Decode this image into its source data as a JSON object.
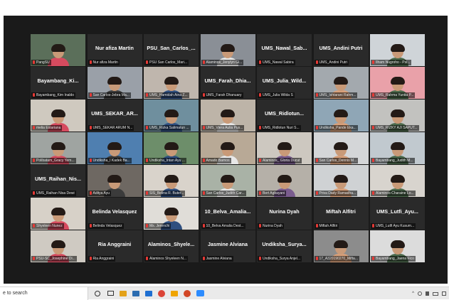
{
  "meeting": {
    "tiles": [
      {
        "label": "PangSU",
        "name": "",
        "kind": "video",
        "active": true,
        "bg": "#5b6f5a"
      },
      {
        "label": "Nur afiza Martin",
        "name": "Nur afiza Martin",
        "kind": "name",
        "active": false
      },
      {
        "label": "PSU San Carlos_Mari...",
        "name": "PSU_San_Carlos_...",
        "kind": "name",
        "active": false
      },
      {
        "label": "Alaminos_Jenylyn Gl...",
        "name": "",
        "kind": "video",
        "active": false,
        "bg": "#8a8f96"
      },
      {
        "label": "UMS_Nawal Sabira",
        "name": "UMS_Nawal_Sab...",
        "kind": "name",
        "active": false
      },
      {
        "label": "UMS_Andini Putri",
        "name": "UMS_Andini Putri",
        "kind": "name",
        "active": false
      },
      {
        "label": "Ilham Nugroho - Psi...",
        "name": "",
        "kind": "video",
        "active": false,
        "bg": "#cfd4d8"
      },
      {
        "label": "Bayambang_Kim Inaldo",
        "name": "Bayambang_Ki...",
        "kind": "name",
        "active": false
      },
      {
        "label": "San Carlos-Jebra Ma...",
        "name": "",
        "kind": "video",
        "active": false,
        "bg": "#9aa0a8"
      },
      {
        "label": "UMS_Hamidah Aina Z...",
        "name": "",
        "kind": "video",
        "active": false,
        "bg": "#bfb6ad"
      },
      {
        "label": "UMS_Farah Dhanuary",
        "name": "UMS_Farah_Dhia...",
        "kind": "name",
        "active": false
      },
      {
        "label": "UMS_Julia Wilda S",
        "name": "UMS_Julia_Wild...",
        "kind": "name",
        "active": false
      },
      {
        "label": "UMS_Ishtarani Rahm...",
        "name": "",
        "kind": "video",
        "active": false,
        "bg": "#a3a9ae"
      },
      {
        "label": "UMS_Rahma Yunita P...",
        "name": "",
        "kind": "video",
        "active": false,
        "bg": "#e9a1a9"
      },
      {
        "label": "melia Estariana",
        "name": "",
        "kind": "video",
        "active": false,
        "bg": "#cfc9bf"
      },
      {
        "label": "UMS_SEKAR ARUM N...",
        "name": "UMS_SEKAR_AR...",
        "kind": "name",
        "active": false
      },
      {
        "label": "UMS_Rizka Salimatun ...",
        "name": "",
        "kind": "video",
        "active": false,
        "bg": "#6f8f9e"
      },
      {
        "label": "UMS_Viera Aulia Pus...",
        "name": "",
        "kind": "video",
        "active": false,
        "bg": "#bdb4a8"
      },
      {
        "label": "UMS_Ridlotun Nuri S...",
        "name": "UMS_Ridlotun...",
        "kind": "name",
        "active": false
      },
      {
        "label": "Undiksha_Pande Eka...",
        "name": "",
        "kind": "video",
        "active": false,
        "bg": "#8fa6b6"
      },
      {
        "label": "UMS_RIZKY AJI SAPUT...",
        "name": "",
        "kind": "video",
        "active": false,
        "bg": "#c2c2bf"
      },
      {
        "label": "Polibatam_Gracy Yem...",
        "name": "",
        "kind": "video",
        "active": false,
        "bg": "#9fa4a1"
      },
      {
        "label": "Undiksha_I Kadek Ba...",
        "name": "",
        "kind": "video",
        "active": false,
        "bg": "#4f7fb0"
      },
      {
        "label": "Undiksha_Intan Ayu ...",
        "name": "",
        "kind": "video",
        "active": false,
        "bg": "#6d8e6a"
      },
      {
        "label": "Amado Barnos",
        "name": "",
        "kind": "video",
        "active": false,
        "bg": "#b8a996"
      },
      {
        "label": "Alaminos_ Gloria Ducut",
        "name": "",
        "kind": "video",
        "active": false,
        "bg": "#cdc8c0"
      },
      {
        "label": "San Carlos_Dennis M...",
        "name": "",
        "kind": "video",
        "active": false,
        "bg": "#d4d6d8"
      },
      {
        "label": "Bayambang_Judith M...",
        "name": "",
        "kind": "video",
        "active": false,
        "bg": "#c1c9cf"
      },
      {
        "label": "UMS_Raihan Nisa Dewi",
        "name": "UMS_Raihan_Nis...",
        "kind": "name",
        "active": false
      },
      {
        "label": "Aditya Ayu",
        "name": "",
        "kind": "video",
        "active": false,
        "bg": "#6e6862"
      },
      {
        "label": "SIS_Belina R. Buter...",
        "name": "",
        "kind": "video",
        "active": false,
        "bg": "#d9d3cb"
      },
      {
        "label": "San Carlos_Judith Car...",
        "name": "",
        "kind": "video",
        "active": false,
        "bg": "#a9b2a6"
      },
      {
        "label": "Bert Agbayani",
        "name": "",
        "kind": "video",
        "active": false,
        "bg": "#b5b0a8"
      },
      {
        "label": "Priva Dady Ramadha...",
        "name": "",
        "kind": "video",
        "active": false,
        "bg": "#cfd2d4"
      },
      {
        "label": "Alaminos-Charaine Lo...",
        "name": "",
        "kind": "video",
        "active": false,
        "bg": "#d8d4ce"
      },
      {
        "label": "Shyeleen Nunez",
        "name": "",
        "kind": "video",
        "active": false,
        "bg": "#d7d1c8"
      },
      {
        "label": "Belinda Velasquez",
        "name": "Belinda Velasquez",
        "kind": "name",
        "active": false
      },
      {
        "label": "Ms. Jerenchi",
        "name": "",
        "kind": "video",
        "active": false,
        "bg": "#e0ddd8"
      },
      {
        "label": "10_Belva Amalia Dest...",
        "name": "10_Belva_Amalia...",
        "kind": "name",
        "active": false
      },
      {
        "label": "Nurina Dyah",
        "name": "Nurina Dyah",
        "kind": "name",
        "active": false
      },
      {
        "label": "Miftah Alfitri",
        "name": "Miftah Alfitri",
        "kind": "name",
        "active": false
      },
      {
        "label": "UMS_Lutfi Ayu Kusum...",
        "name": "UMS_Lutfi_Ayu...",
        "kind": "name",
        "active": false
      },
      {
        "label": "PSU-SC_Josephine Di...",
        "name": "",
        "kind": "video",
        "active": false,
        "bg": "#cfcac2"
      },
      {
        "label": "Ria Anggraini",
        "name": "Ria Anggraini",
        "kind": "name",
        "active": false
      },
      {
        "label": "Alaminos Shyeleen N...",
        "name": "Alaminos_Shyele...",
        "kind": "name",
        "active": false
      },
      {
        "label": "Jasmine Alviana",
        "name": "Jasmine Alviana",
        "kind": "name",
        "active": false
      },
      {
        "label": "Undiksha_Surya Anjel...",
        "name": "Undiksha_Surya...",
        "kind": "name",
        "active": false
      },
      {
        "label": "17_A320190270_Mifta...",
        "name": "",
        "kind": "video",
        "active": false,
        "bg": "#8c8c8c"
      },
      {
        "label": "Bayambang_Jaena Fico",
        "name": "",
        "kind": "video",
        "active": false,
        "bg": "#dcdcdc"
      }
    ]
  },
  "taskbar": {
    "search_placeholder": "e to search",
    "apps": [
      {
        "icon": "cortana-icon",
        "color": "#333333"
      },
      {
        "icon": "task-view-icon",
        "color": "#333333"
      },
      {
        "icon": "file-explorer-icon",
        "color": "#e3a21a"
      },
      {
        "icon": "store-icon",
        "color": "#2b6cb0"
      },
      {
        "icon": "mail-icon",
        "color": "#1f6fd1"
      },
      {
        "icon": "chrome-icon",
        "color": "#db4437"
      },
      {
        "icon": "files-icon",
        "color": "#f0a500"
      },
      {
        "icon": "powerpoint-icon",
        "color": "#d24726"
      },
      {
        "icon": "zoom-icon",
        "color": "#2d8cff"
      }
    ]
  },
  "colors": {
    "active_border": "#a6e22e",
    "mic_muted": "#e53935"
  }
}
